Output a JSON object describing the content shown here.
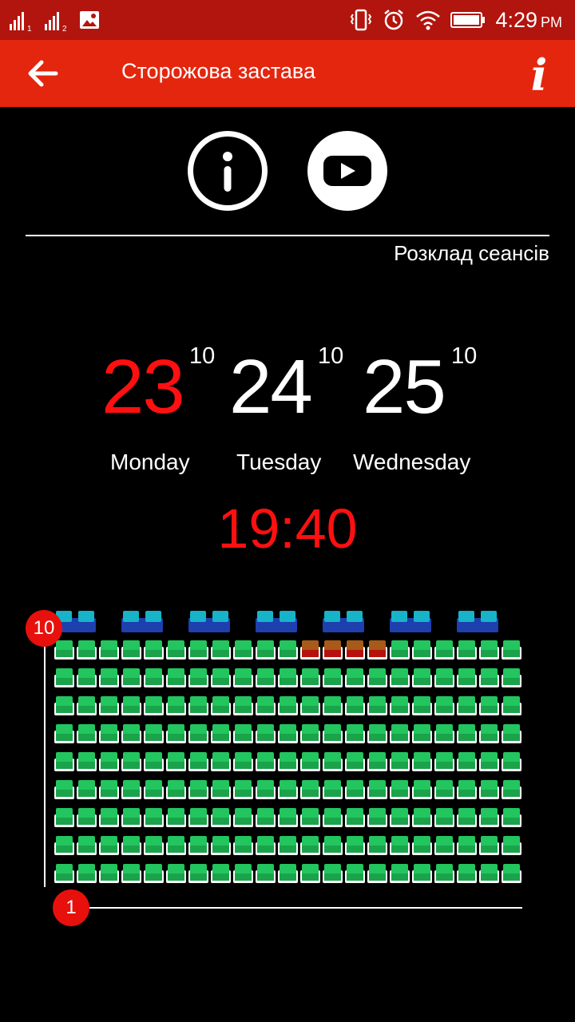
{
  "status_bar": {
    "sim1_label": "1",
    "sim2_label": "2",
    "time": "4:29",
    "ampm": "PM",
    "icons": [
      "signal-icon",
      "signal-icon",
      "image-icon",
      "vibrate-icon",
      "alarm-icon",
      "wifi-icon",
      "battery-icon"
    ]
  },
  "app_bar": {
    "title": "Сторожова застава",
    "info_glyph": "i"
  },
  "schedule_label": "Розклад сеансів",
  "dates": [
    {
      "day": "23",
      "month": "10",
      "weekday": "Monday",
      "selected": true
    },
    {
      "day": "24",
      "month": "10",
      "weekday": "Tuesday",
      "selected": false
    },
    {
      "day": "25",
      "month": "10",
      "weekday": "Wednesday",
      "selected": false
    }
  ],
  "session_time": "19:40",
  "hall": {
    "first_row_label": "1",
    "last_row_label": "10",
    "rows": 10,
    "seats_per_row": 21,
    "vip_pairs": 7,
    "occupied": [
      {
        "row": 9,
        "seats": [
          11,
          12,
          13,
          14
        ]
      }
    ],
    "colors": {
      "free": "#1aa34a",
      "free_top": "#22c55e",
      "occupied": "#b8100c",
      "occupied_top": "#a85a18",
      "vip": "#1e3fae",
      "vip_top": "#17b3c9",
      "badge": "#e8100c"
    }
  },
  "colors": {
    "status_bar": "#b2140e",
    "app_bar": "#e4260e",
    "accent_red": "#ff1010"
  }
}
